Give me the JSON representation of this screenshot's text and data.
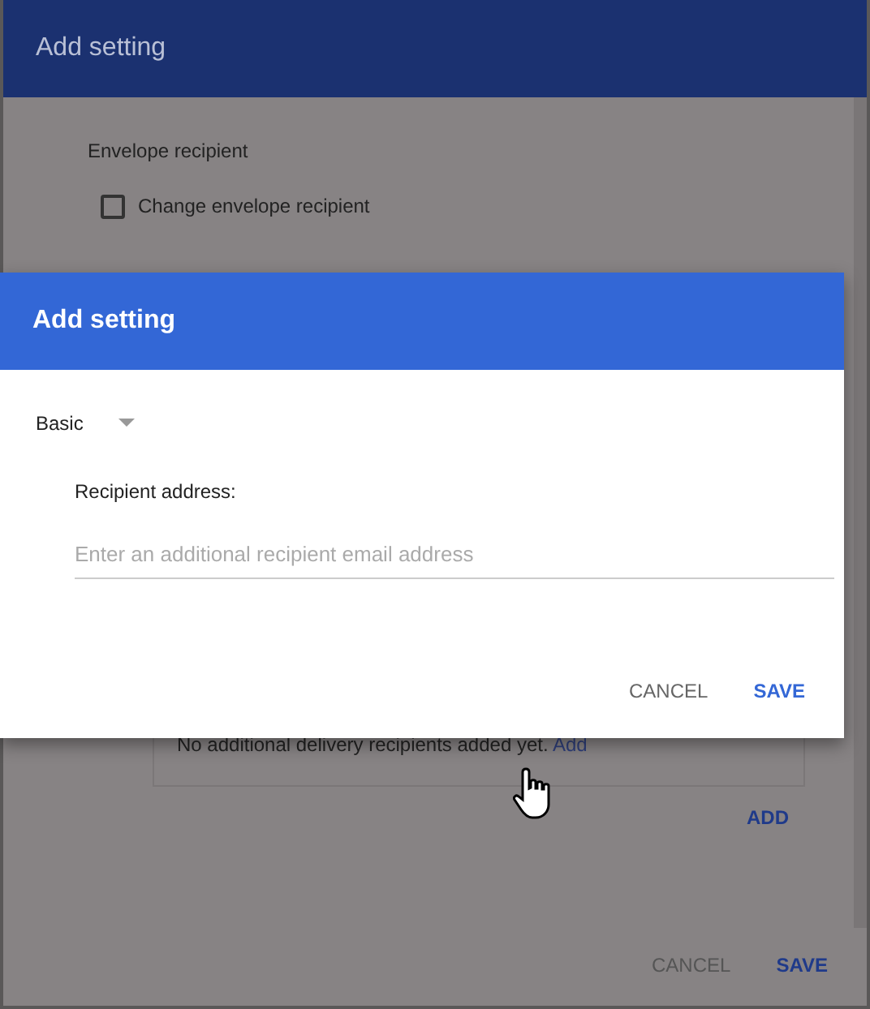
{
  "background": {
    "title": "Add setting",
    "section_label": "Envelope recipient",
    "checkbox": {
      "label": "Change envelope recipient",
      "checked": false
    },
    "recipients_note": "No additional delivery recipients added yet.",
    "recipients_link": "Add",
    "add_button": "ADD",
    "buttons": [
      {
        "label": "CANCEL",
        "kind": "secondary"
      },
      {
        "label": "SAVE",
        "kind": "primary"
      }
    ]
  },
  "dialog": {
    "title": "Add setting",
    "mode": "Basic",
    "field": {
      "label": "Recipient address:",
      "placeholder": "Enter an additional recipient email address"
    },
    "buttons": [
      {
        "label": "CANCEL",
        "kind": "secondary"
      },
      {
        "label": "SAVE",
        "kind": "primary"
      }
    ]
  }
}
